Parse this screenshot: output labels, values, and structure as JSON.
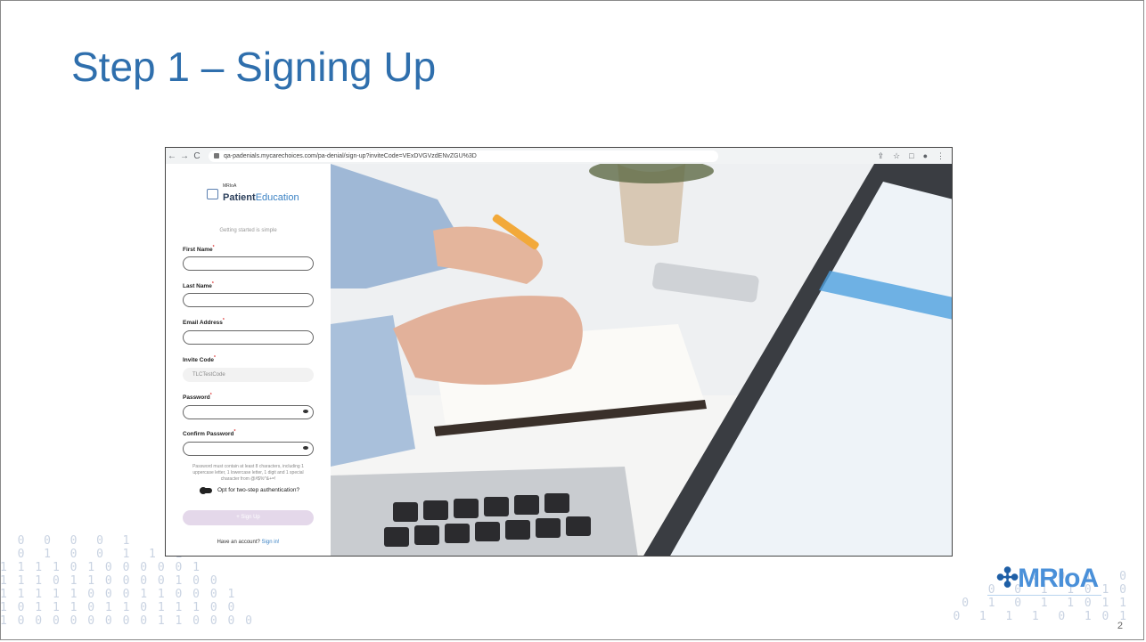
{
  "slide": {
    "title": "Step 1 – Signing Up",
    "page_number": "2",
    "logo_text": "MRIoA"
  },
  "browser": {
    "url": "qa-padenials.mycarechoices.com/pa-denial/sign-up?inviteCode=VExDVGVzdENvZGU%3D"
  },
  "form": {
    "brand_small": "MRIoA",
    "brand_name_bold": "Patient",
    "brand_name_light": "Education",
    "tagline": "Getting started is simple",
    "fields": [
      {
        "label": "First Name",
        "value": ""
      },
      {
        "label": "Last Name",
        "value": ""
      },
      {
        "label": "Email Address",
        "value": ""
      },
      {
        "label": "Invite Code",
        "value": "TLCTestCode"
      },
      {
        "label": "Password",
        "value": ""
      },
      {
        "label": "Confirm Password",
        "value": ""
      }
    ],
    "password_hint": "Password must contain at least 8 characters, including 1 uppercase letter, 1 lowercase letter, 1 digit and 1 special character from @#$%^&+=!",
    "two_step_label": "Opt for two-step authentication?",
    "signup_button": "+ Sign Up",
    "have_account_text": "Have an account?",
    "sign_in_link": "Sign in!"
  },
  "colors": {
    "title": "#2f6fad",
    "signup_button": "#e4d8ea",
    "link": "#3b82c4"
  }
}
